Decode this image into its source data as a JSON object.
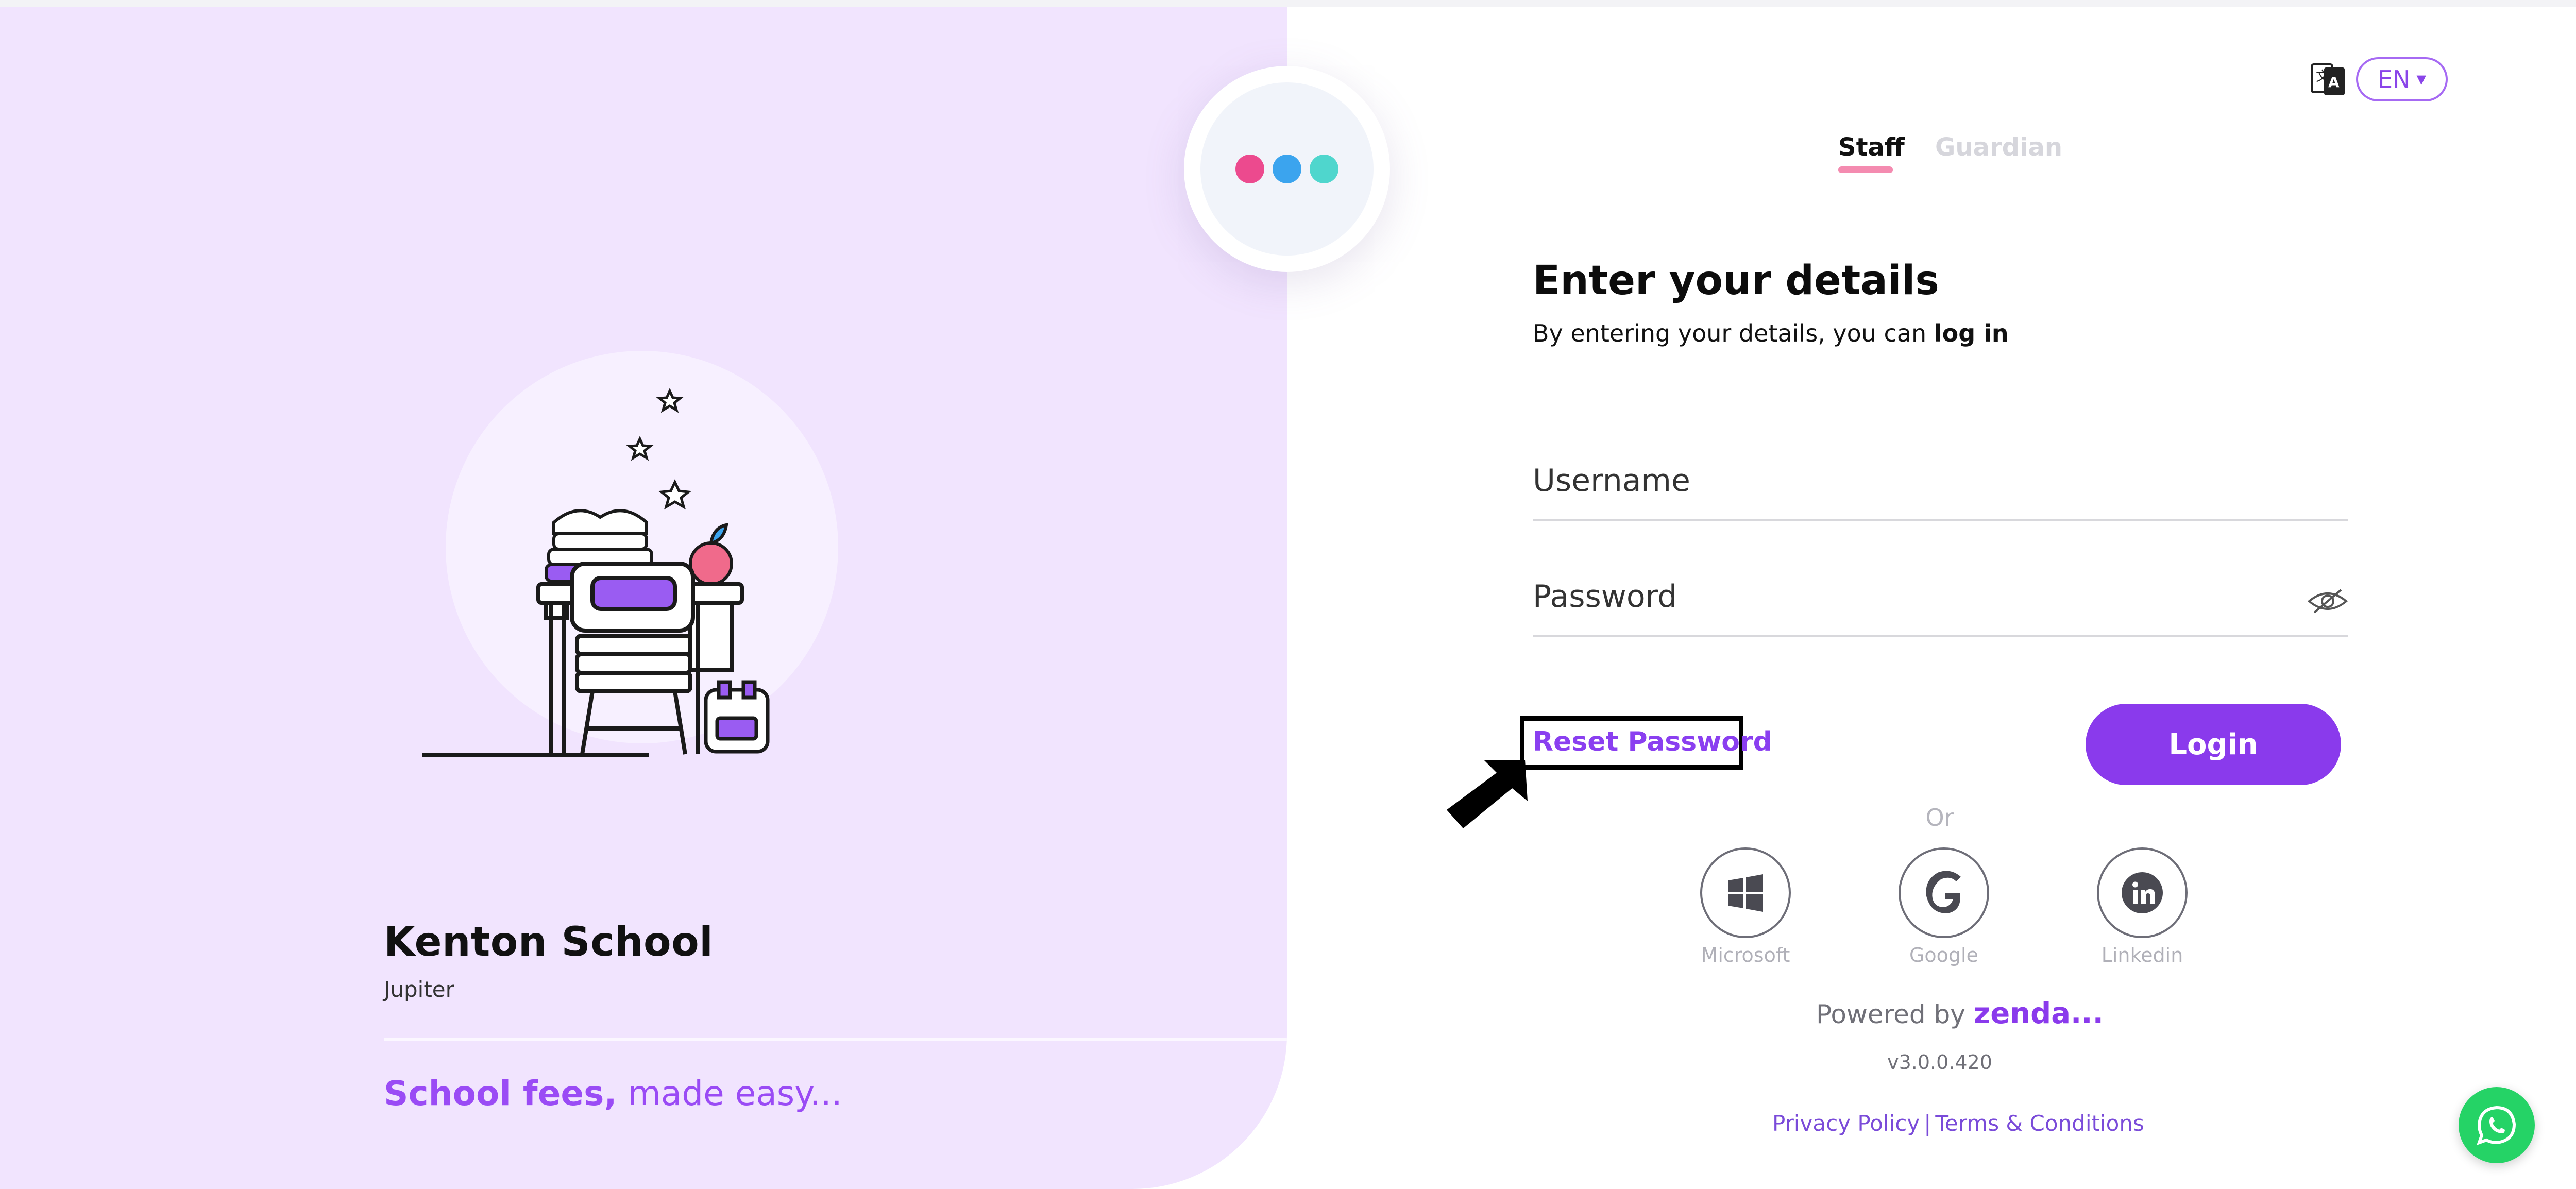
{
  "brand": {
    "logo_dot_colors": [
      "#ec4a8e",
      "#3ba4ee",
      "#4fd6cd"
    ]
  },
  "left_panel": {
    "school_name": "Kenton School",
    "school_location": "Jupiter",
    "tagline_bold": "School fees,",
    "tagline_rest": "made easy..."
  },
  "language": {
    "selected": "EN"
  },
  "tabs": [
    {
      "label": "Staff",
      "active": true
    },
    {
      "label": "Guardian",
      "active": false
    }
  ],
  "form": {
    "heading": "Enter your details",
    "subheading_prefix": "By entering your details, you can",
    "subheading_bold": "log in",
    "username_placeholder": "Username",
    "password_placeholder": "Password",
    "reset_label": "Reset Password",
    "login_label": "Login",
    "or_label": "Or"
  },
  "social": [
    {
      "label": "Microsoft",
      "icon": "windows-icon"
    },
    {
      "label": "Google",
      "icon": "google-icon"
    },
    {
      "label": "Linkedin",
      "icon": "linkedin-icon"
    }
  ],
  "footer": {
    "powered_by": "Powered by",
    "powered_brand": "zenda...",
    "version": "v3.0.0.420",
    "privacy": "Privacy Policy",
    "separator": "|",
    "terms": "Terms & Conditions"
  },
  "colors": {
    "accent": "#8a3aec",
    "panel_bg": "#f1e4fe",
    "tab_underline": "#f48bb0",
    "whatsapp": "#25d366"
  }
}
